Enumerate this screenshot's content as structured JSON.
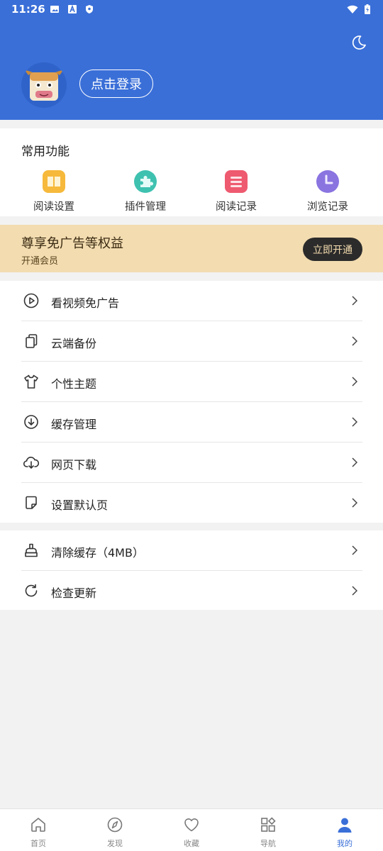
{
  "status_bar": {
    "time": "11:26"
  },
  "header": {
    "login_label": "点击登录",
    "theme_icon": "moon-icon",
    "avatar_icon": "cow-avatar",
    "bg_color": "#3a6fd8"
  },
  "common": {
    "title": "常用功能",
    "items": [
      {
        "label": "阅读设置",
        "icon": "book-icon",
        "color": "#f6b93b"
      },
      {
        "label": "插件管理",
        "icon": "puzzle-icon",
        "color": "#3fc1b0"
      },
      {
        "label": "阅读记录",
        "icon": "list-icon",
        "color": "#ee5a6f"
      },
      {
        "label": "浏览记录",
        "icon": "clock-icon",
        "color": "#8a74e0"
      }
    ]
  },
  "vip": {
    "title": "尊享免广告等权益",
    "subtitle": "开通会员",
    "button": "立即开通"
  },
  "menu1": [
    {
      "label": "看视频免广告",
      "icon": "play-circle-icon"
    },
    {
      "label": "云端备份",
      "icon": "copy-icon"
    },
    {
      "label": "个性主题",
      "icon": "tshirt-icon"
    },
    {
      "label": "缓存管理",
      "icon": "download-circle-icon"
    },
    {
      "label": "网页下载",
      "icon": "cloud-download-icon"
    },
    {
      "label": "设置默认页",
      "icon": "note-icon"
    }
  ],
  "menu2": [
    {
      "label": "清除缓存（4MB）",
      "icon": "broom-icon"
    },
    {
      "label": "检查更新",
      "icon": "refresh-icon"
    }
  ],
  "bottom_nav": {
    "items": [
      {
        "label": "首页",
        "icon": "home-icon"
      },
      {
        "label": "发现",
        "icon": "compass-icon"
      },
      {
        "label": "收藏",
        "icon": "heart-icon"
      },
      {
        "label": "导航",
        "icon": "grid-icon"
      },
      {
        "label": "我的",
        "icon": "user-icon"
      }
    ],
    "active": "我的",
    "active_color": "#3a6fd8"
  }
}
